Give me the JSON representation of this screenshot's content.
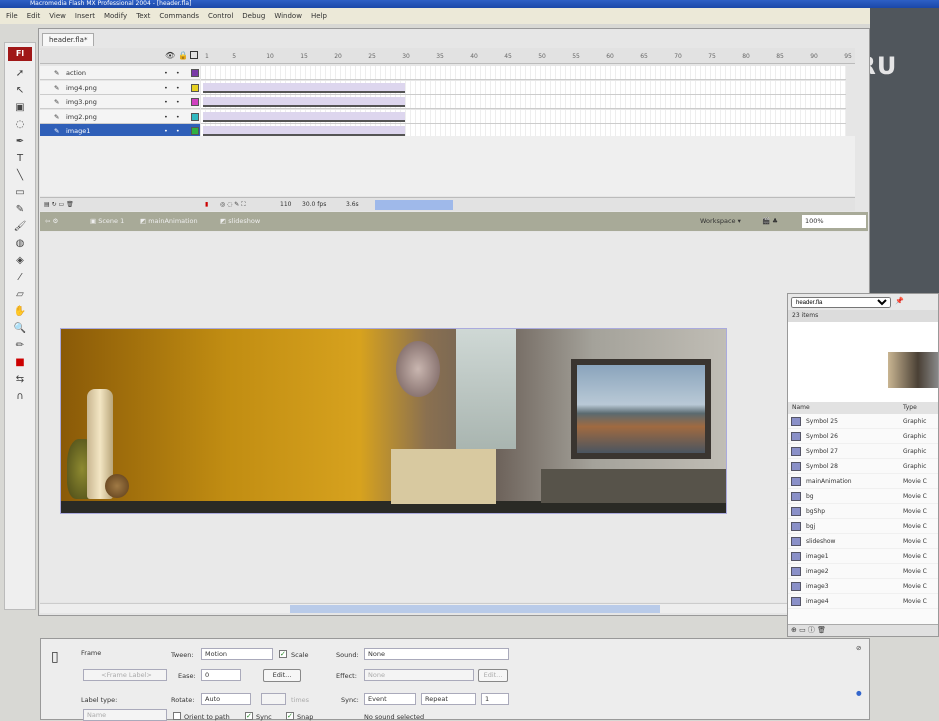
{
  "window": {
    "title": "Macromedia Flash MX Professional 2004 - [header.fla]"
  },
  "menu": [
    "File",
    "Edit",
    "View",
    "Insert",
    "Modify",
    "Text",
    "Commands",
    "Control",
    "Debug",
    "Window",
    "Help"
  ],
  "watermark": "WEBGURU",
  "document_tab": "header.fla*",
  "toolbar": {
    "logo": "Fl"
  },
  "timeline": {
    "ruler": [
      "1",
      "5",
      "10",
      "15",
      "20",
      "25",
      "30",
      "35",
      "40",
      "45",
      "50",
      "55",
      "60",
      "65",
      "70",
      "75",
      "80",
      "85",
      "90",
      "95"
    ],
    "layers": [
      {
        "name": "action",
        "color": "#7a3aa8",
        "tween": false
      },
      {
        "name": "img4.png",
        "color": "#e6d020",
        "tween": true
      },
      {
        "name": "img3.png",
        "color": "#d040c0",
        "tween": true
      },
      {
        "name": "img2.png",
        "color": "#30b8c0",
        "tween": true
      },
      {
        "name": "image1",
        "color": "#30b040",
        "tween": true,
        "selected": true
      }
    ],
    "status": {
      "frame": "110",
      "fps": "30.0 fps",
      "time": "3.6s"
    }
  },
  "editbar": {
    "breadcrumbs": [
      "Scene 1",
      "mainAnimation",
      "slideshow"
    ],
    "workspace": "Workspace ▾",
    "zoom": "100%"
  },
  "library": {
    "document": "header.fla",
    "count": "23 items",
    "columns": [
      "Name",
      "Type"
    ],
    "items": [
      {
        "name": "Symbol 25",
        "type": "Graphic"
      },
      {
        "name": "Symbol 26",
        "type": "Graphic"
      },
      {
        "name": "Symbol 27",
        "type": "Graphic"
      },
      {
        "name": "Symbol 28",
        "type": "Graphic"
      },
      {
        "name": "mainAnimation",
        "type": "Movie C"
      },
      {
        "name": "bg",
        "type": "Movie C"
      },
      {
        "name": "bgShp",
        "type": "Movie C"
      },
      {
        "name": "bgj",
        "type": "Movie C"
      },
      {
        "name": "slideshow",
        "type": "Movie C"
      },
      {
        "name": "image1",
        "type": "Movie C"
      },
      {
        "name": "image2",
        "type": "Movie C"
      },
      {
        "name": "image3",
        "type": "Movie C"
      },
      {
        "name": "image4",
        "type": "Movie C"
      }
    ]
  },
  "properties": {
    "type": "Frame",
    "frame_label_placeholder": "<Frame Label>",
    "label_type_label": "Label type:",
    "label_type_value": "Name",
    "tween_label": "Tween:",
    "tween_value": "Motion",
    "scale_label": "Scale",
    "ease_label": "Ease:",
    "ease_value": "0",
    "edit_label": "Edit...",
    "rotate_label": "Rotate:",
    "rotate_value": "Auto",
    "times_label": "times",
    "orient_label": "Orient to path",
    "sync_cb_label": "Sync",
    "snap_label": "Snap",
    "sound_label": "Sound:",
    "sound_value": "None",
    "effect_label": "Effect:",
    "effect_value": "None",
    "sync_label": "Sync:",
    "sync_value": "Event",
    "repeat_value": "Repeat",
    "repeat_count": "1",
    "no_sound": "No sound selected"
  }
}
